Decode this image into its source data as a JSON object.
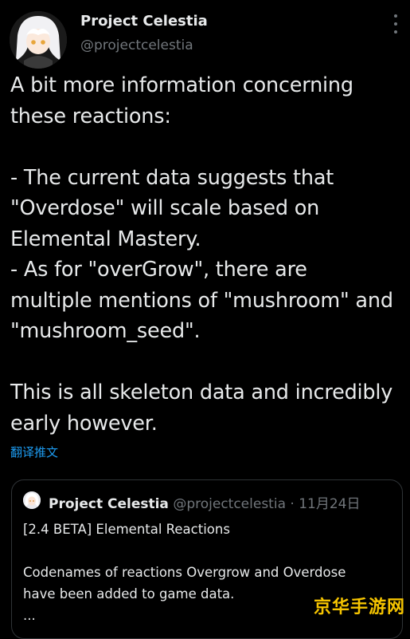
{
  "author": {
    "name": "Project Celestia",
    "handle": "@projectcelestia"
  },
  "tweet": {
    "text": "A bit more information concerning\nthese reactions:\n\n- The current data suggests that\n\"Overdose\" will scale based on\nElemental Mastery.\n- As for \"overGrow\", there are\nmultiple mentions of \"mushroom\" and\n\"mushroom_seed\".\n\nThis is all skeleton data and incredibly\nearly however.",
    "translate_label": "翻译推文"
  },
  "quoted_tweet": {
    "name": "Project Celestia",
    "handle": "@projectcelestia",
    "separator": "·",
    "date": "11月24日",
    "text": "[2.4 BETA] Elemental Reactions\n\nCodenames of reactions Overgrow and Overdose\nhave been added to game data.\n..."
  },
  "watermark": "京华手游网",
  "icons": {
    "more": "more-vertical-icon",
    "avatar": "avatar-anime-girl"
  },
  "colors": {
    "background": "#000000",
    "text": "#e7e9ea",
    "secondary": "#71767b",
    "link": "#1d9bf0",
    "watermark": "#f5c400"
  }
}
